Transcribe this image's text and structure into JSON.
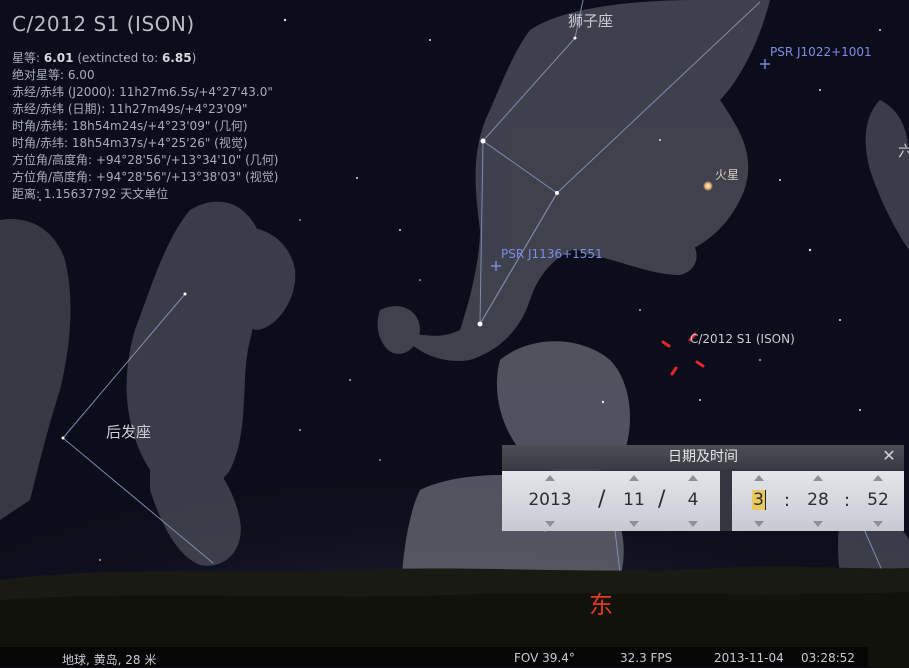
{
  "object_info": {
    "title": "C/2012 S1 (ISON)",
    "magnitude_label": "星等:",
    "magnitude_value": "6.01",
    "extincted_label": "(extincted to:",
    "extincted_value": "6.85",
    "extincted_close": ")",
    "lines": [
      "绝对星等: 6.00",
      "赤经/赤纬 (J2000): 11h27m6.5s/+4°27'43.0\"",
      "赤经/赤纬 (日期): 11h27m49s/+4°23'09\"",
      "时角/赤纬: 18h54m24s/+4°23'09\" (几何)",
      "时角/赤纬: 18h54m37s/+4°25'26\" (视觉)",
      "方位角/高度角: +94°28'56\"/+13°34'10\" (几何)",
      "方位角/高度角: +94°28'56\"/+13°38'03\" (视觉)",
      "距离: 1.15637792 天文单位"
    ]
  },
  "sky_labels": {
    "leo": "狮子座",
    "coma": "后发座",
    "edge_glyph": "六",
    "psr_1": "PSR J1022+1001",
    "psr_2": "PSR J1136+1551",
    "mars": "火星",
    "comet": "C/2012 S1 (ISON)",
    "east": "东"
  },
  "colors": {
    "sky": "#0c0d1a",
    "psr_marker": "#7c8de6",
    "comet_marker": "#e0282a",
    "cardinal": "#e03a22",
    "highlight": "#e9c85e"
  },
  "datetime_dialog": {
    "title": "日期及时间",
    "close_icon": "close-icon",
    "year": "2013",
    "month": "11",
    "day": "4",
    "date_sep": "/",
    "hour": "3",
    "minute": "28",
    "second": "52",
    "time_sep": ":"
  },
  "statusbar": {
    "location": "地球, 黄岛, 28 米",
    "fov": "FOV 39.4°",
    "fps": "32.3 FPS",
    "date": "2013-11-04",
    "time": "03:28:52"
  }
}
